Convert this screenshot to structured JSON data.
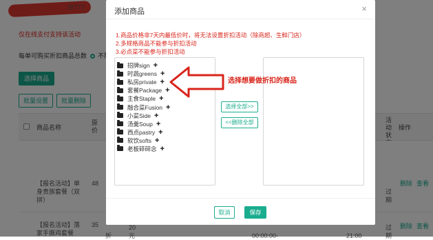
{
  "background": {
    "title_suffix": "/9777",
    "notice": "仅在线支付支持该活动",
    "limit_label": "每单可购买折扣商品总数",
    "limit_option": "不限",
    "select_products_button": "选择商品",
    "batch_set_button": "批量设置",
    "batch_delete_button": "批量删除",
    "table": {
      "headers": {
        "product_name": "商品名称",
        "original_price": "原价",
        "activity_status": "活动状态",
        "actions": "操作"
      },
      "rows": [
        {
          "name": "【报名活动】单身贵族套餐（双拼）",
          "price": "48",
          "status": "过期",
          "delete": "删除",
          "view": "查看"
        },
        {
          "name": "【报名活动】落家手撕鸡套餐",
          "price": "35",
          "price_suffix": "折",
          "extra1": "20",
          "extra2": "元",
          "time1": "00:00:00-",
          "time2": "21:00",
          "status": "过期",
          "delete": "删除",
          "view": "查看"
        }
      ]
    }
  },
  "modal": {
    "title": "添加商品",
    "close": "×",
    "rules": [
      "1.商品价格非7天内最低价时，将无法设置折扣活动（除商超、生鲜门店）",
      "2.多规格商品不能参与折扣活动",
      "3.必点菜不能参与折扣活动"
    ],
    "categories": [
      {
        "label": "招牌sign"
      },
      {
        "label": "时蔬greens"
      },
      {
        "label": "私房private"
      },
      {
        "label": "套餐Package"
      },
      {
        "label": "主食Staple"
      },
      {
        "label": "融合菜Fusion"
      },
      {
        "label": "小菜Side"
      },
      {
        "label": "汤羹Soup"
      },
      {
        "label": "西点pastry"
      },
      {
        "label": "软饮softs"
      },
      {
        "label": "老板碎碎念"
      }
    ],
    "select_all": "选择全部>>",
    "delete_all": "<<删除全部",
    "annotation": "选择想要做折扣的商品",
    "cancel": "取消",
    "save": "保存"
  },
  "colors": {
    "accent": "#1aad8e",
    "alert": "#d9241a",
    "overlay": "rgba(0,0,0,0.5)"
  }
}
